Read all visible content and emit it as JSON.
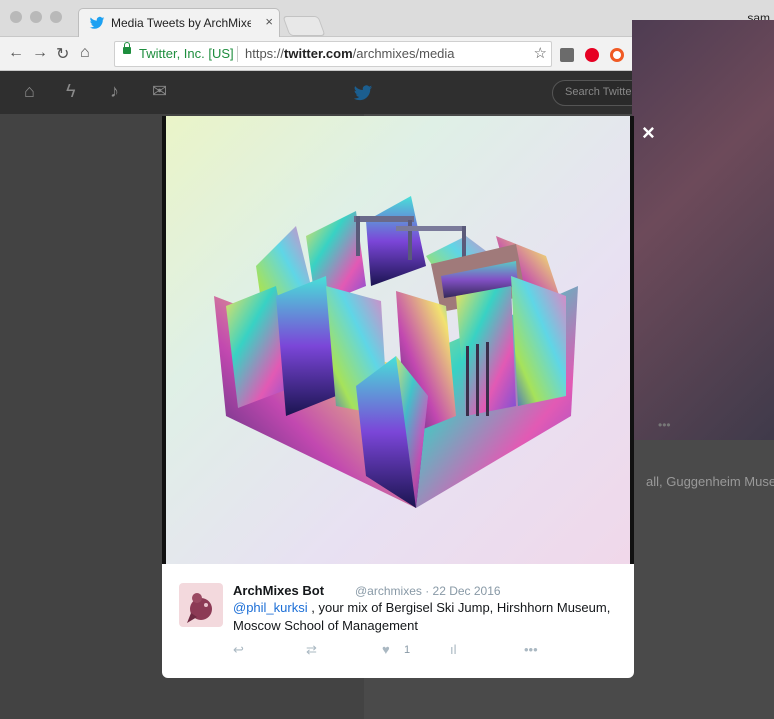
{
  "browser": {
    "tab_title": "Media Tweets by ArchMixes Bo",
    "tab_close": "×",
    "user_label": "sam",
    "secure_label": "Twitter, Inc. [US]",
    "url_prefix": "https://",
    "url_host": "twitter.com",
    "url_path": "/archmixes/media"
  },
  "twitter_nav": {
    "search_placeholder": "Search Twitter"
  },
  "lightbox": {
    "close_label": "×"
  },
  "tweet": {
    "author_name": "ArchMixes Bot",
    "meta": "@archmixes · 22 Dec 2016",
    "mention": "@phil_kurksi",
    "text_rest": " , your mix of Bergisel Ski Jump, Hirshhorn Museum, Moscow School of Management",
    "like_count": "1"
  },
  "background_page": {
    "partial_text": "all, Guggenheim Muse"
  },
  "colors": {
    "twitter_blue": "#1da1f2",
    "link_blue": "#1b6ed6",
    "compose_purple": "#4a58c8",
    "secure_green": "#1e8e3e"
  }
}
